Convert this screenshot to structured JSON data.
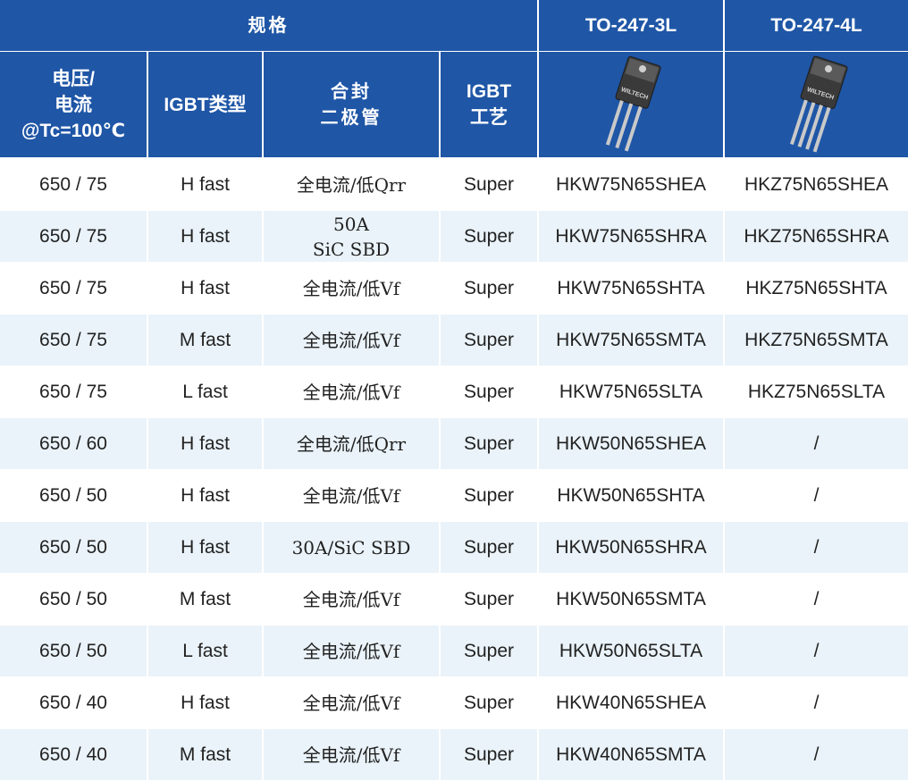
{
  "colors": {
    "header_bg": "#1f56a6",
    "header_text": "#ffffff",
    "stripe": "#eaf3f9"
  },
  "header": {
    "spec": "规格",
    "pkg3": "TO-247-3L",
    "pkg4": "TO-247-4L",
    "col_voltage": "电压/\n电流\n@Tc=100℃",
    "col_igbt_type": "IGBT类型",
    "col_diode": "合封\n二极管",
    "col_process": "IGBT\n工艺",
    "pkg3_icon": "to-247-3l-package-image",
    "pkg4_icon": "to-247-4l-package-image",
    "pkg_brand": "WILTECH"
  },
  "rows": [
    {
      "vi": "650 / 75",
      "type": "H fast",
      "diode": "全电流/低Qrr",
      "proc": "Super",
      "p3": "HKW75N65SHEA",
      "p4": "HKZ75N65SHEA"
    },
    {
      "vi": "650 / 75",
      "type": "H fast",
      "diode": "50A\nSiC SBD",
      "proc": "Super",
      "p3": "HKW75N65SHRA",
      "p4": "HKZ75N65SHRA"
    },
    {
      "vi": "650 / 75",
      "type": "H fast",
      "diode": "全电流/低Vf",
      "proc": "Super",
      "p3": "HKW75N65SHTA",
      "p4": "HKZ75N65SHTA"
    },
    {
      "vi": "650 / 75",
      "type": "M fast",
      "diode": "全电流/低Vf",
      "proc": "Super",
      "p3": "HKW75N65SMTA",
      "p4": "HKZ75N65SMTA"
    },
    {
      "vi": "650 / 75",
      "type": "L fast",
      "diode": "全电流/低Vf",
      "proc": "Super",
      "p3": "HKW75N65SLTA",
      "p4": "HKZ75N65SLTA"
    },
    {
      "vi": "650 / 60",
      "type": "H fast",
      "diode": "全电流/低Qrr",
      "proc": "Super",
      "p3": "HKW50N65SHEA",
      "p4": "/"
    },
    {
      "vi": "650 / 50",
      "type": "H fast",
      "diode": "全电流/低Vf",
      "proc": "Super",
      "p3": "HKW50N65SHTA",
      "p4": "/"
    },
    {
      "vi": "650 / 50",
      "type": "H fast",
      "diode": "30A/SiC SBD",
      "proc": "Super",
      "p3": "HKW50N65SHRA",
      "p4": "/"
    },
    {
      "vi": "650 / 50",
      "type": "M fast",
      "diode": "全电流/低Vf",
      "proc": "Super",
      "p3": "HKW50N65SMTA",
      "p4": "/"
    },
    {
      "vi": "650 / 50",
      "type": "L fast",
      "diode": "全电流/低Vf",
      "proc": "Super",
      "p3": "HKW50N65SLTA",
      "p4": "/"
    },
    {
      "vi": "650 / 40",
      "type": "H fast",
      "diode": "全电流/低Vf",
      "proc": "Super",
      "p3": "HKW40N65SHEA",
      "p4": "/"
    },
    {
      "vi": "650 / 40",
      "type": "M fast",
      "diode": "全电流/低Vf",
      "proc": "Super",
      "p3": "HKW40N65SMTA",
      "p4": "/"
    }
  ]
}
